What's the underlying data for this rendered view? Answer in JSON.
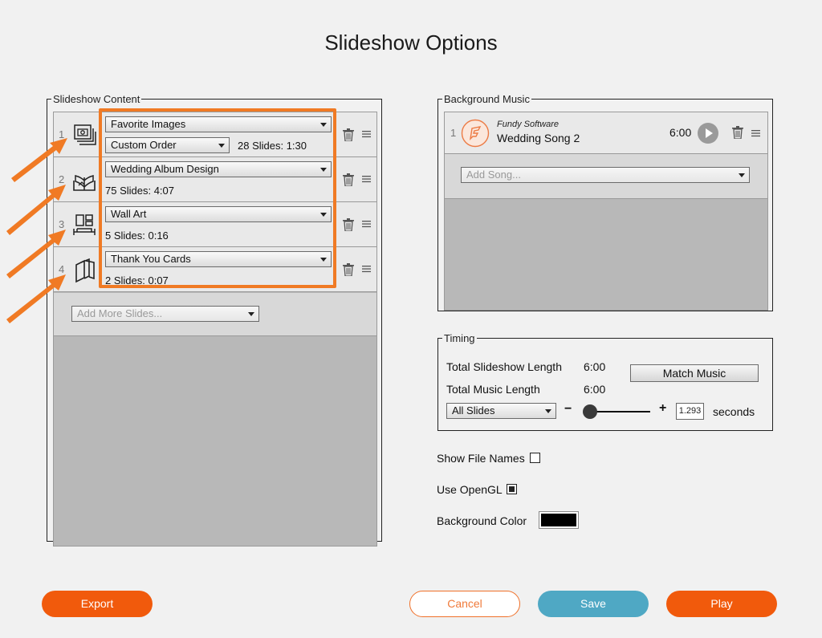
{
  "window": {
    "title": "Slideshow Options"
  },
  "content": {
    "legend": "Slideshow Content",
    "rows": [
      {
        "num": "1",
        "icon": "photo-stack-icon",
        "source": "Favorite Images",
        "order": "Custom Order",
        "info": "28 Slides: 1:30"
      },
      {
        "num": "2",
        "icon": "open-album-icon",
        "source": "Wedding Album Design",
        "info": "75 Slides: 4:07"
      },
      {
        "num": "3",
        "icon": "wall-art-icon",
        "source": "Wall Art",
        "info": "5 Slides: 0:16"
      },
      {
        "num": "4",
        "icon": "cards-icon",
        "source": "Thank You Cards",
        "info": "2 Slides: 0:07"
      }
    ],
    "add_placeholder": "Add More Slides..."
  },
  "music": {
    "legend": "Background Music",
    "song": {
      "num": "1",
      "artist": "Fundy Software",
      "title": "Wedding Song 2",
      "duration": "6:00"
    },
    "add_placeholder": "Add Song..."
  },
  "timing": {
    "legend": "Timing",
    "total_slideshow_label": "Total Slideshow Length",
    "total_slideshow_value": "6:00",
    "total_music_label": "Total Music Length",
    "total_music_value": "6:00",
    "match_music_label": "Match Music",
    "scope_value": "All Slides",
    "minus": "−",
    "plus": "+",
    "seconds_value": "1.293",
    "seconds_label": "seconds",
    "slider_fraction": 0.08
  },
  "options": {
    "show_file_names_label": "Show File Names",
    "show_file_names_checked": false,
    "use_opengl_label": "Use OpenGL",
    "use_opengl_checked": true,
    "background_color_label": "Background Color",
    "background_color": "#000000"
  },
  "buttons": {
    "export": "Export",
    "cancel": "Cancel",
    "save": "Save",
    "play": "Play"
  },
  "colors": {
    "accent": "#f15a0c",
    "highlight": "#f07a24",
    "save": "#4fa8c4"
  }
}
